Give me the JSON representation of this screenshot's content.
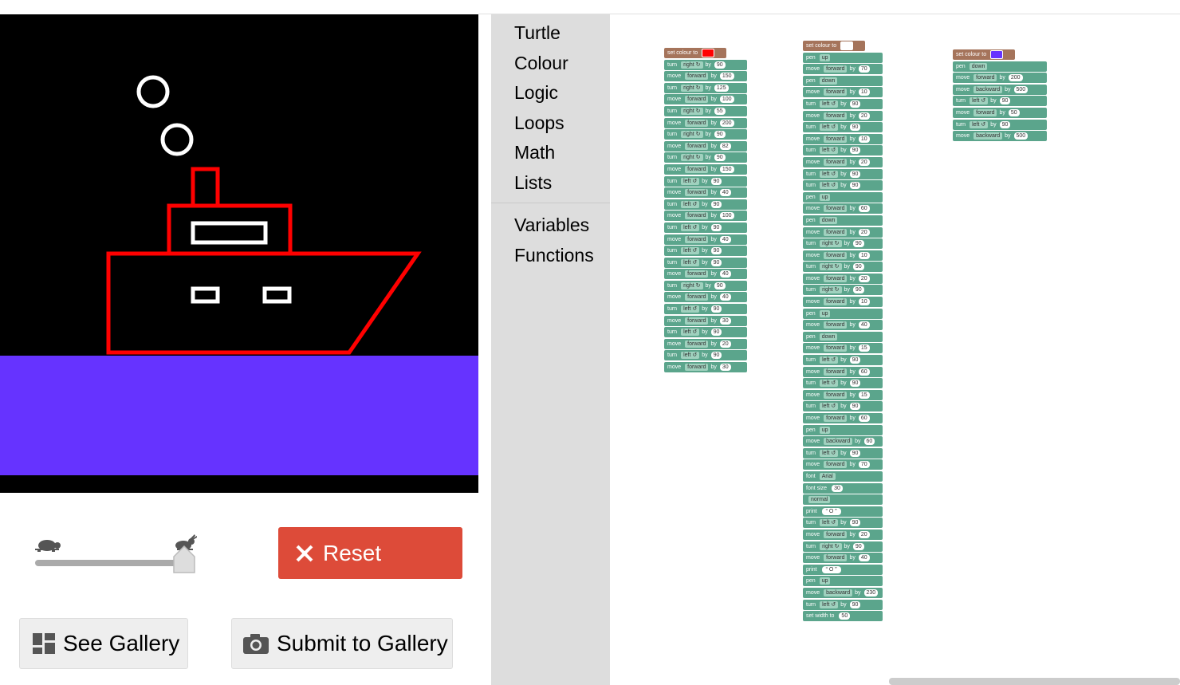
{
  "canvas": {
    "background": "#000000",
    "sea_colour": "#6633ff",
    "ship_colour": "#ff0000",
    "detail_colour": "#ffffff"
  },
  "controls": {
    "slow_icon": "turtle-icon",
    "fast_icon": "rabbit-icon",
    "speed": 1.0,
    "reset_label": "Reset",
    "gallery_label": "See Gallery",
    "submit_label": "Submit to Gallery"
  },
  "toolbox": {
    "categories": [
      "Turtle",
      "Colour",
      "Logic",
      "Loops",
      "Math",
      "Lists"
    ],
    "categories2": [
      "Variables",
      "Functions"
    ]
  },
  "workspace": {
    "stacks": [
      {
        "colour_label": "set colour to",
        "colour": "#ff0000",
        "blocks": [
          [
            "turn",
            "right ↻",
            "90"
          ],
          [
            "move",
            "forward",
            "150"
          ],
          [
            "turn",
            "right ↻",
            "125"
          ],
          [
            "move",
            "forward",
            "100"
          ],
          [
            "turn",
            "right ↻",
            "55"
          ],
          [
            "move",
            "forward",
            "200"
          ],
          [
            "turn",
            "right ↻",
            "90"
          ],
          [
            "move",
            "forward",
            "82"
          ],
          [
            "turn",
            "right ↻",
            "90"
          ],
          [
            "move",
            "forward",
            "150"
          ],
          [
            "turn",
            "left ↺",
            "90"
          ],
          [
            "move",
            "forward",
            "40"
          ],
          [
            "turn",
            "left ↺",
            "90"
          ],
          [
            "move",
            "forward",
            "100"
          ],
          [
            "turn",
            "left ↺",
            "90"
          ],
          [
            "move",
            "forward",
            "40"
          ],
          [
            "turn",
            "left ↺",
            "90"
          ],
          [
            "turn",
            "left ↺",
            "90"
          ],
          [
            "move",
            "forward",
            "40"
          ],
          [
            "turn",
            "right ↻",
            "90"
          ],
          [
            "move",
            "forward",
            "40"
          ],
          [
            "turn",
            "left ↺",
            "90"
          ],
          [
            "move",
            "forward",
            "30"
          ],
          [
            "turn",
            "left ↺",
            "90"
          ],
          [
            "move",
            "forward",
            "20"
          ],
          [
            "turn",
            "left ↺",
            "90"
          ],
          [
            "move",
            "forward",
            "30"
          ]
        ]
      },
      {
        "colour_label": "set colour to",
        "colour": "#ffffff",
        "blocks": [
          [
            "pen",
            "up",
            ""
          ],
          [
            "move",
            "forward",
            "70"
          ],
          [
            "pen",
            "down",
            ""
          ],
          [
            "move",
            "forward",
            "10"
          ],
          [
            "turn",
            "left ↺",
            "90"
          ],
          [
            "move",
            "forward",
            "20"
          ],
          [
            "turn",
            "left ↺",
            "90"
          ],
          [
            "move",
            "forward",
            "10"
          ],
          [
            "turn",
            "left ↺",
            "90"
          ],
          [
            "move",
            "forward",
            "20"
          ],
          [
            "turn",
            "left ↺",
            "90"
          ],
          [
            "turn",
            "left ↺",
            "90"
          ],
          [
            "pen",
            "up",
            ""
          ],
          [
            "move",
            "forward",
            "60"
          ],
          [
            "pen",
            "down",
            ""
          ],
          [
            "move",
            "forward",
            "20"
          ],
          [
            "turn",
            "right ↻",
            "90"
          ],
          [
            "move",
            "forward",
            "10"
          ],
          [
            "turn",
            "right ↻",
            "90"
          ],
          [
            "move",
            "forward",
            "20"
          ],
          [
            "turn",
            "right ↻",
            "90"
          ],
          [
            "move",
            "forward",
            "10"
          ],
          [
            "pen",
            "up",
            ""
          ],
          [
            "move",
            "forward",
            "40"
          ],
          [
            "pen",
            "down",
            ""
          ],
          [
            "move",
            "forward",
            "15"
          ],
          [
            "turn",
            "left ↺",
            "90"
          ],
          [
            "move",
            "forward",
            "60"
          ],
          [
            "turn",
            "left ↺",
            "90"
          ],
          [
            "move",
            "forward",
            "15"
          ],
          [
            "turn",
            "left ↺",
            "90"
          ],
          [
            "move",
            "forward",
            "60"
          ],
          [
            "pen",
            "up",
            ""
          ],
          [
            "move",
            "backward",
            "60"
          ],
          [
            "turn",
            "left ↺",
            "90"
          ],
          [
            "move",
            "forward",
            "70"
          ],
          [
            "font",
            "Arial",
            ""
          ],
          [
            "font size",
            "",
            "30"
          ],
          [
            "",
            "normal",
            ""
          ],
          [
            "print",
            "",
            "“ O ”"
          ],
          [
            "turn",
            "left ↺",
            "90"
          ],
          [
            "move",
            "forward",
            "20"
          ],
          [
            "turn",
            "right ↻",
            "90"
          ],
          [
            "move",
            "forward",
            "40"
          ],
          [
            "print",
            "",
            "“ O ”"
          ],
          [
            "pen",
            "up",
            ""
          ],
          [
            "move",
            "backward",
            "230"
          ],
          [
            "turn",
            "left ↺",
            "90"
          ],
          [
            "set width to",
            "",
            "50"
          ]
        ]
      },
      {
        "colour_label": "set colour to",
        "colour": "#6633ff",
        "blocks": [
          [
            "pen",
            "down",
            ""
          ],
          [
            "move",
            "forward",
            "200"
          ],
          [
            "move",
            "backward",
            "500"
          ],
          [
            "turn",
            "left ↺",
            "90"
          ],
          [
            "move",
            "forward",
            "50"
          ],
          [
            "turn",
            "left ↺",
            "90"
          ],
          [
            "move",
            "backward",
            "500"
          ]
        ]
      }
    ]
  }
}
